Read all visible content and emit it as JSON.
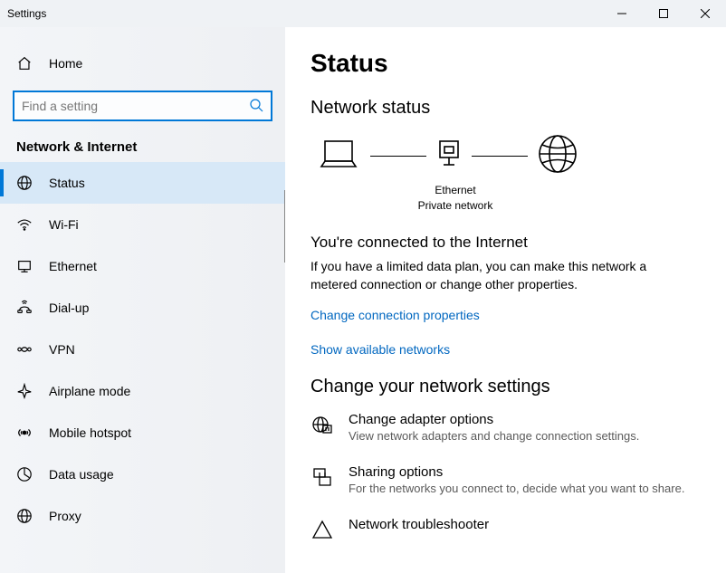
{
  "window": {
    "title": "Settings"
  },
  "sidebar": {
    "home": "Home",
    "search_placeholder": "Find a setting",
    "category": "Network & Internet",
    "items": [
      {
        "label": "Status",
        "selected": true
      },
      {
        "label": "Wi-Fi"
      },
      {
        "label": "Ethernet"
      },
      {
        "label": "Dial-up"
      },
      {
        "label": "VPN"
      },
      {
        "label": "Airplane mode"
      },
      {
        "label": "Mobile hotspot"
      },
      {
        "label": "Data usage"
      },
      {
        "label": "Proxy"
      }
    ]
  },
  "content": {
    "title": "Status",
    "section1_title": "Network status",
    "diagram": {
      "conn_name": "Ethernet",
      "conn_type": "Private network"
    },
    "status_head": "You're connected to the Internet",
    "status_body": "If you have a limited data plan, you can make this network a metered connection or change other properties.",
    "link1": "Change connection properties",
    "link2": "Show available networks",
    "section2_title": "Change your network settings",
    "options": [
      {
        "title": "Change adapter options",
        "desc": "View network adapters and change connection settings."
      },
      {
        "title": "Sharing options",
        "desc": "For the networks you connect to, decide what you want to share."
      },
      {
        "title": "Network troubleshooter",
        "desc": ""
      }
    ]
  }
}
